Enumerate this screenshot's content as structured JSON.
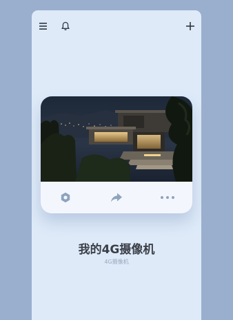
{
  "header": {
    "menu_icon": "hamburger-menu-icon",
    "notification_icon": "bell-icon",
    "add_icon": "plus-icon"
  },
  "device_card": {
    "preview_image": "night-modern-house-photo",
    "actions": [
      {
        "icon": "gear-settings-icon"
      },
      {
        "icon": "share-arrow-icon"
      },
      {
        "icon": "more-dots-icon"
      }
    ]
  },
  "device": {
    "name": "我的4G摄像机",
    "type": "4G摄像机"
  },
  "colors": {
    "background": "#9aafcd",
    "panel": "#deeaf8",
    "card": "#f3f7fd",
    "icon": "#8ea3bd",
    "title_text": "#3b3f47"
  }
}
